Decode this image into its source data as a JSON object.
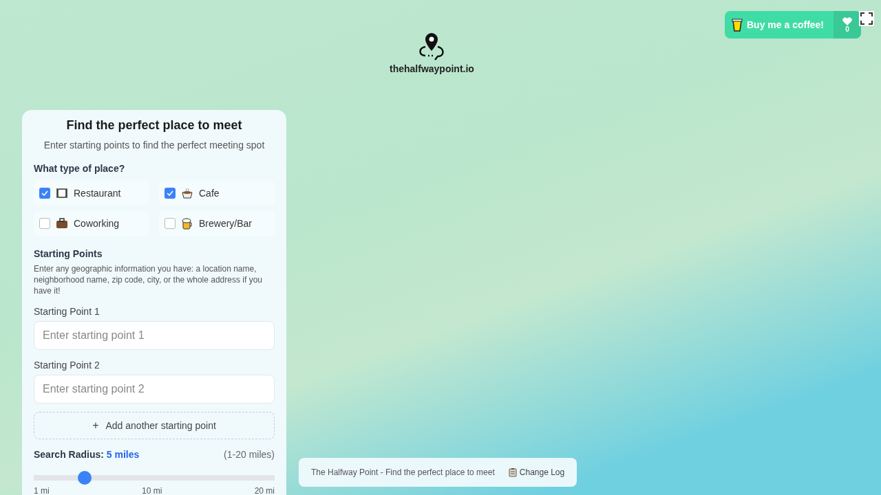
{
  "logo": {
    "text": "thehalfwaypoint.io"
  },
  "coffee_button": {
    "label": "Buy me a coffee!",
    "count": "0"
  },
  "panel": {
    "title": "Find the perfect place to meet",
    "subtitle": "Enter starting points to find the perfect meeting spot",
    "place_type": {
      "heading": "What type of place?",
      "options": [
        {
          "label": "Restaurant",
          "kind": "restaurant",
          "checked": true
        },
        {
          "label": "Cafe",
          "kind": "cafe",
          "checked": true
        },
        {
          "label": "Coworking",
          "kind": "coworking",
          "checked": false
        },
        {
          "label": "Brewery/Bar",
          "kind": "bar",
          "checked": false
        }
      ]
    },
    "starting_points": {
      "heading": "Starting Points",
      "help": "Enter any geographic information you have: a location name, neighborhood name, zip code, city, or the whole address if you have it!",
      "fields": [
        {
          "label": "Starting Point 1",
          "placeholder": "Enter starting point 1"
        },
        {
          "label": "Starting Point 2",
          "placeholder": "Enter starting point 2"
        }
      ],
      "add_button": {
        "icon": "+",
        "label": "Add another starting point"
      }
    },
    "radius": {
      "label": "Search Radius:",
      "value": "5 miles",
      "range": "(1-20 miles)",
      "level": 0.21,
      "ticks": [
        "1 mi",
        "10 mi",
        "20 mi"
      ]
    }
  },
  "footer": {
    "text": "The Halfway Point - Find the perfect place to meet",
    "link": "Change Log"
  }
}
